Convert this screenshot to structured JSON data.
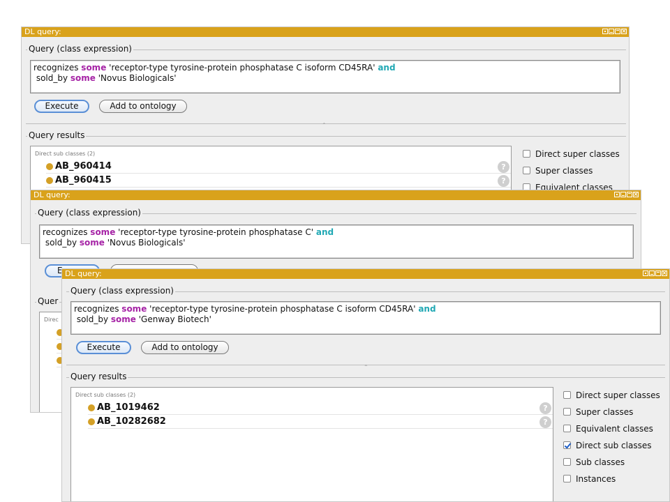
{
  "windows": [
    {
      "title": "DL query:",
      "query_group_label": "Query (class expression)",
      "query": {
        "line1_pre": "recognizes ",
        "line1_some": "some",
        "line1_mid": " 'receptor-type tyrosine-protein phosphatase C isoform CD45RA' ",
        "line1_and": "and",
        "line2_pre": "sold_by ",
        "line2_some": "some",
        "line2_post": " 'Novus Biologicals'"
      },
      "execute_label": "Execute",
      "add_label": "Add to ontology",
      "results_group_label": "Query results",
      "results_header": "Direct sub classes (2)",
      "results": [
        "AB_960414",
        "AB_960415"
      ],
      "help_glyph": "?",
      "options": [
        "Direct super classes",
        "Super classes",
        "Equivalent classes"
      ]
    },
    {
      "title": "DL query:",
      "query_group_label": "Query (class expression)",
      "query": {
        "line1_pre": "recognizes ",
        "line1_some": "some",
        "line1_mid": " 'receptor-type tyrosine-protein phosphatase C' ",
        "line1_and": "and",
        "line2_pre": "sold_by ",
        "line2_some": "some",
        "line2_post": " 'Novus Biologicals'"
      },
      "execute_partial": "E",
      "results_group_partial": "Quer",
      "results_header_partial": "Direc"
    },
    {
      "title": "DL query:",
      "query_group_label": "Query (class expression)",
      "query": {
        "line1_pre": "recognizes ",
        "line1_some": "some",
        "line1_mid": " 'receptor-type tyrosine-protein phosphatase C isoform CD45RA' ",
        "line1_and": "and",
        "line2_pre": "sold_by ",
        "line2_some": "some",
        "line2_post": " 'Genway Biotech'"
      },
      "execute_label": "Execute",
      "add_label": "Add to ontology",
      "results_group_label": "Query results",
      "results_header": "Direct sub classes (2)",
      "results": [
        "AB_1019462",
        "AB_10282682"
      ],
      "help_glyph": "?",
      "options": [
        {
          "label": "Direct super classes",
          "checked": false
        },
        {
          "label": "Super classes",
          "checked": false
        },
        {
          "label": "Equivalent classes",
          "checked": false
        },
        {
          "label": "Direct sub classes",
          "checked": true
        },
        {
          "label": "Sub classes",
          "checked": false
        },
        {
          "label": "Instances",
          "checked": false
        }
      ]
    }
  ],
  "colors": {
    "titlebar": "#d9a21b",
    "keyword_some": "#a624a6",
    "keyword_and": "#20a8b4",
    "class_dot": "#d4a026",
    "checkbox_check": "#1e5fc9"
  },
  "icons": [
    "minimize-icon",
    "maximize-icon",
    "float-icon",
    "close-icon",
    "class-dot-icon",
    "help-icon",
    "checkbox-icon"
  ]
}
